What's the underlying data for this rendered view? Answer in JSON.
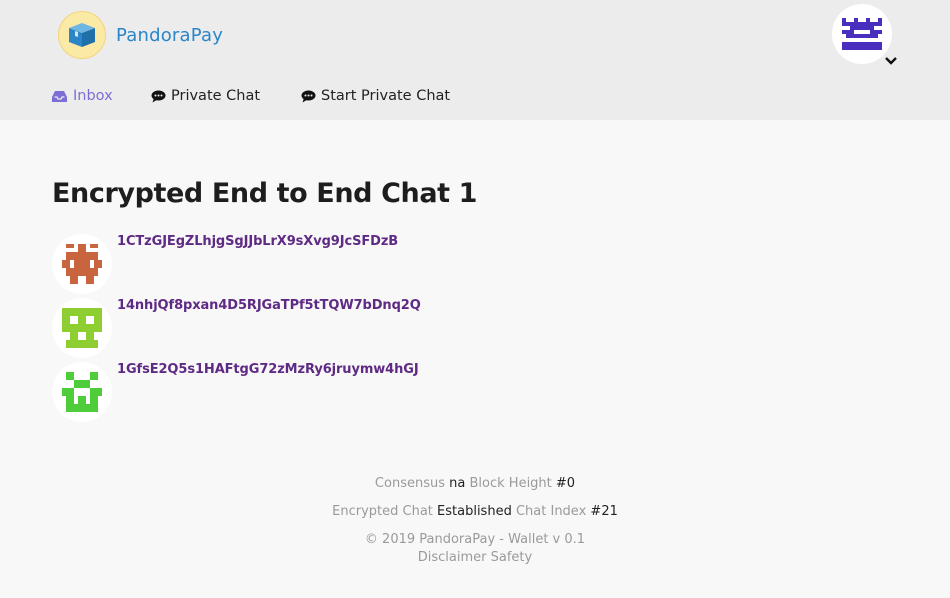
{
  "header": {
    "app_name": "PandoraPay",
    "icons": {
      "logo": "pandora-box-icon",
      "user_avatar": "identicon-avatar",
      "dropdown": "chevron-down-icon"
    }
  },
  "nav": {
    "items": [
      {
        "label": "Inbox",
        "icon": "inbox-icon",
        "active": true
      },
      {
        "label": "Private Chat",
        "icon": "comment-icon",
        "active": false
      },
      {
        "label": "Start Private Chat",
        "icon": "comment-icon",
        "active": false
      }
    ]
  },
  "colors": {
    "accent": "#7b6fd6",
    "address": "#5e2a83",
    "logo_text": "#2a86c9",
    "avatar_top": "#4a2fbf",
    "avatar_1": "#c8643e",
    "avatar_2": "#8fce31",
    "avatar_3": "#4ecc3a"
  },
  "main": {
    "title": "Encrypted End to End Chat 1",
    "participants": [
      {
        "address": "1CTzGJEgZLhjgSgJJbLrX9sXvg9JcSFDzB"
      },
      {
        "address": "14nhjQf8pxan4D5RJGaTPf5tTQW7bDnq2Q"
      },
      {
        "address": "1GfsE2Q5s1HAFtgG72zMzRy6jruymw4hGJ"
      }
    ]
  },
  "footer": {
    "consensus_label": "Consensus",
    "consensus_value": "na",
    "block_height_label": "Block Height",
    "block_height_value": "#0",
    "encrypted_chat_label": "Encrypted Chat",
    "encrypted_chat_value": "Established",
    "chat_index_label": "Chat Index",
    "chat_index_value": "#21",
    "copyright": "© 2019 PandoraPay - Wallet v 0.1",
    "disclaimer": "Disclaimer",
    "safety": "Safety"
  }
}
